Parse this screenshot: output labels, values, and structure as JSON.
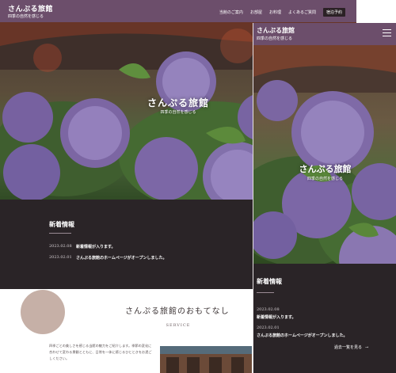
{
  "site": {
    "name": "さんぷる旅館",
    "tagline": "四季の自然を感じる"
  },
  "nav": {
    "items": [
      "当館のご案内",
      "お部屋",
      "お料理",
      "よくあるご質問"
    ],
    "reserve_label": "宿泊予約"
  },
  "hero": {
    "title": "さんぷる旅館",
    "subtitle": "四季の自然を感じる"
  },
  "news": {
    "title": "新着情報",
    "items": [
      {
        "date": "2023.02.08",
        "text": "新着情報が入ります。"
      },
      {
        "date": "2023.02.01",
        "text": "さんぷる旅館のホームページがオープンしました。"
      }
    ],
    "more_label": "過去一覧を見る",
    "more_arrow": "→"
  },
  "service": {
    "title": "さんぷる旅館のおもてなし",
    "subtitle": "SERVICE",
    "body": "四季ごとの美しさを感じる当館の魅力をご紹介します。季節の変化に合わせて変わる景観とともに、日常を一体に感じるひとときをお過ごしください。"
  },
  "colors": {
    "header": "#6c4e6b",
    "dark": "#2a2427",
    "accent_circle": "#c6b0a7"
  },
  "icons": {
    "menu": "hamburger-icon"
  }
}
